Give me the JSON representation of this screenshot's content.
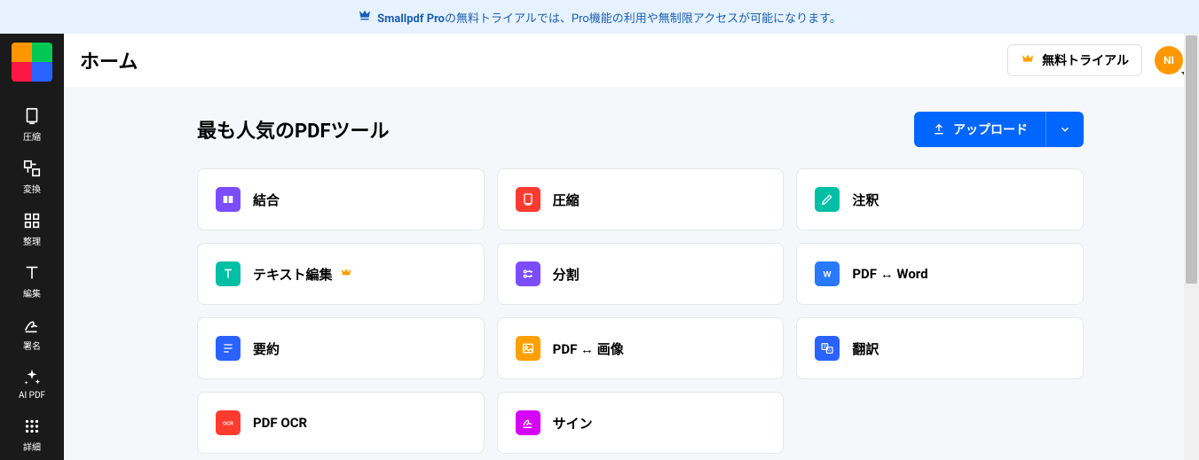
{
  "promo": {
    "text_prefix": "Smallpdf Pro",
    "text_suffix": "の無料トライアルでは、Pro機能の利用や無制限アクセスが可能になります。"
  },
  "header": {
    "title": "ホーム",
    "trial_button": "無料トライアル",
    "avatar_initials": "NI"
  },
  "sidebar": {
    "items": [
      {
        "label": "圧縮"
      },
      {
        "label": "変換"
      },
      {
        "label": "整理"
      },
      {
        "label": "編集"
      },
      {
        "label": "署名"
      },
      {
        "label": "AI PDF"
      },
      {
        "label": "詳細"
      }
    ]
  },
  "section": {
    "title": "最も人気のPDFツール",
    "upload_label": "アップロード"
  },
  "tools": [
    {
      "label": "結合",
      "color": "#7c4dff",
      "icon": "merge"
    },
    {
      "label": "圧縮",
      "color": "#ff3b30",
      "icon": "compress"
    },
    {
      "label": "注釈",
      "color": "#00bfa5",
      "icon": "annotate"
    },
    {
      "label": "テキスト編集",
      "color": "#00bfa5",
      "icon": "text",
      "pro": true
    },
    {
      "label": "分割",
      "color": "#7c4dff",
      "icon": "split"
    },
    {
      "label": "PDF ↔ Word",
      "color": "#2979ff",
      "icon": "word"
    },
    {
      "label": "要約",
      "color": "#2962ff",
      "icon": "summary"
    },
    {
      "label": "PDF ↔ 画像",
      "color": "#ffa000",
      "icon": "image"
    },
    {
      "label": "翻訳",
      "color": "#2962ff",
      "icon": "translate"
    },
    {
      "label": "PDF OCR",
      "color": "#ff3b30",
      "icon": "ocr"
    },
    {
      "label": "サイン",
      "color": "#d500f9",
      "icon": "sign"
    }
  ]
}
